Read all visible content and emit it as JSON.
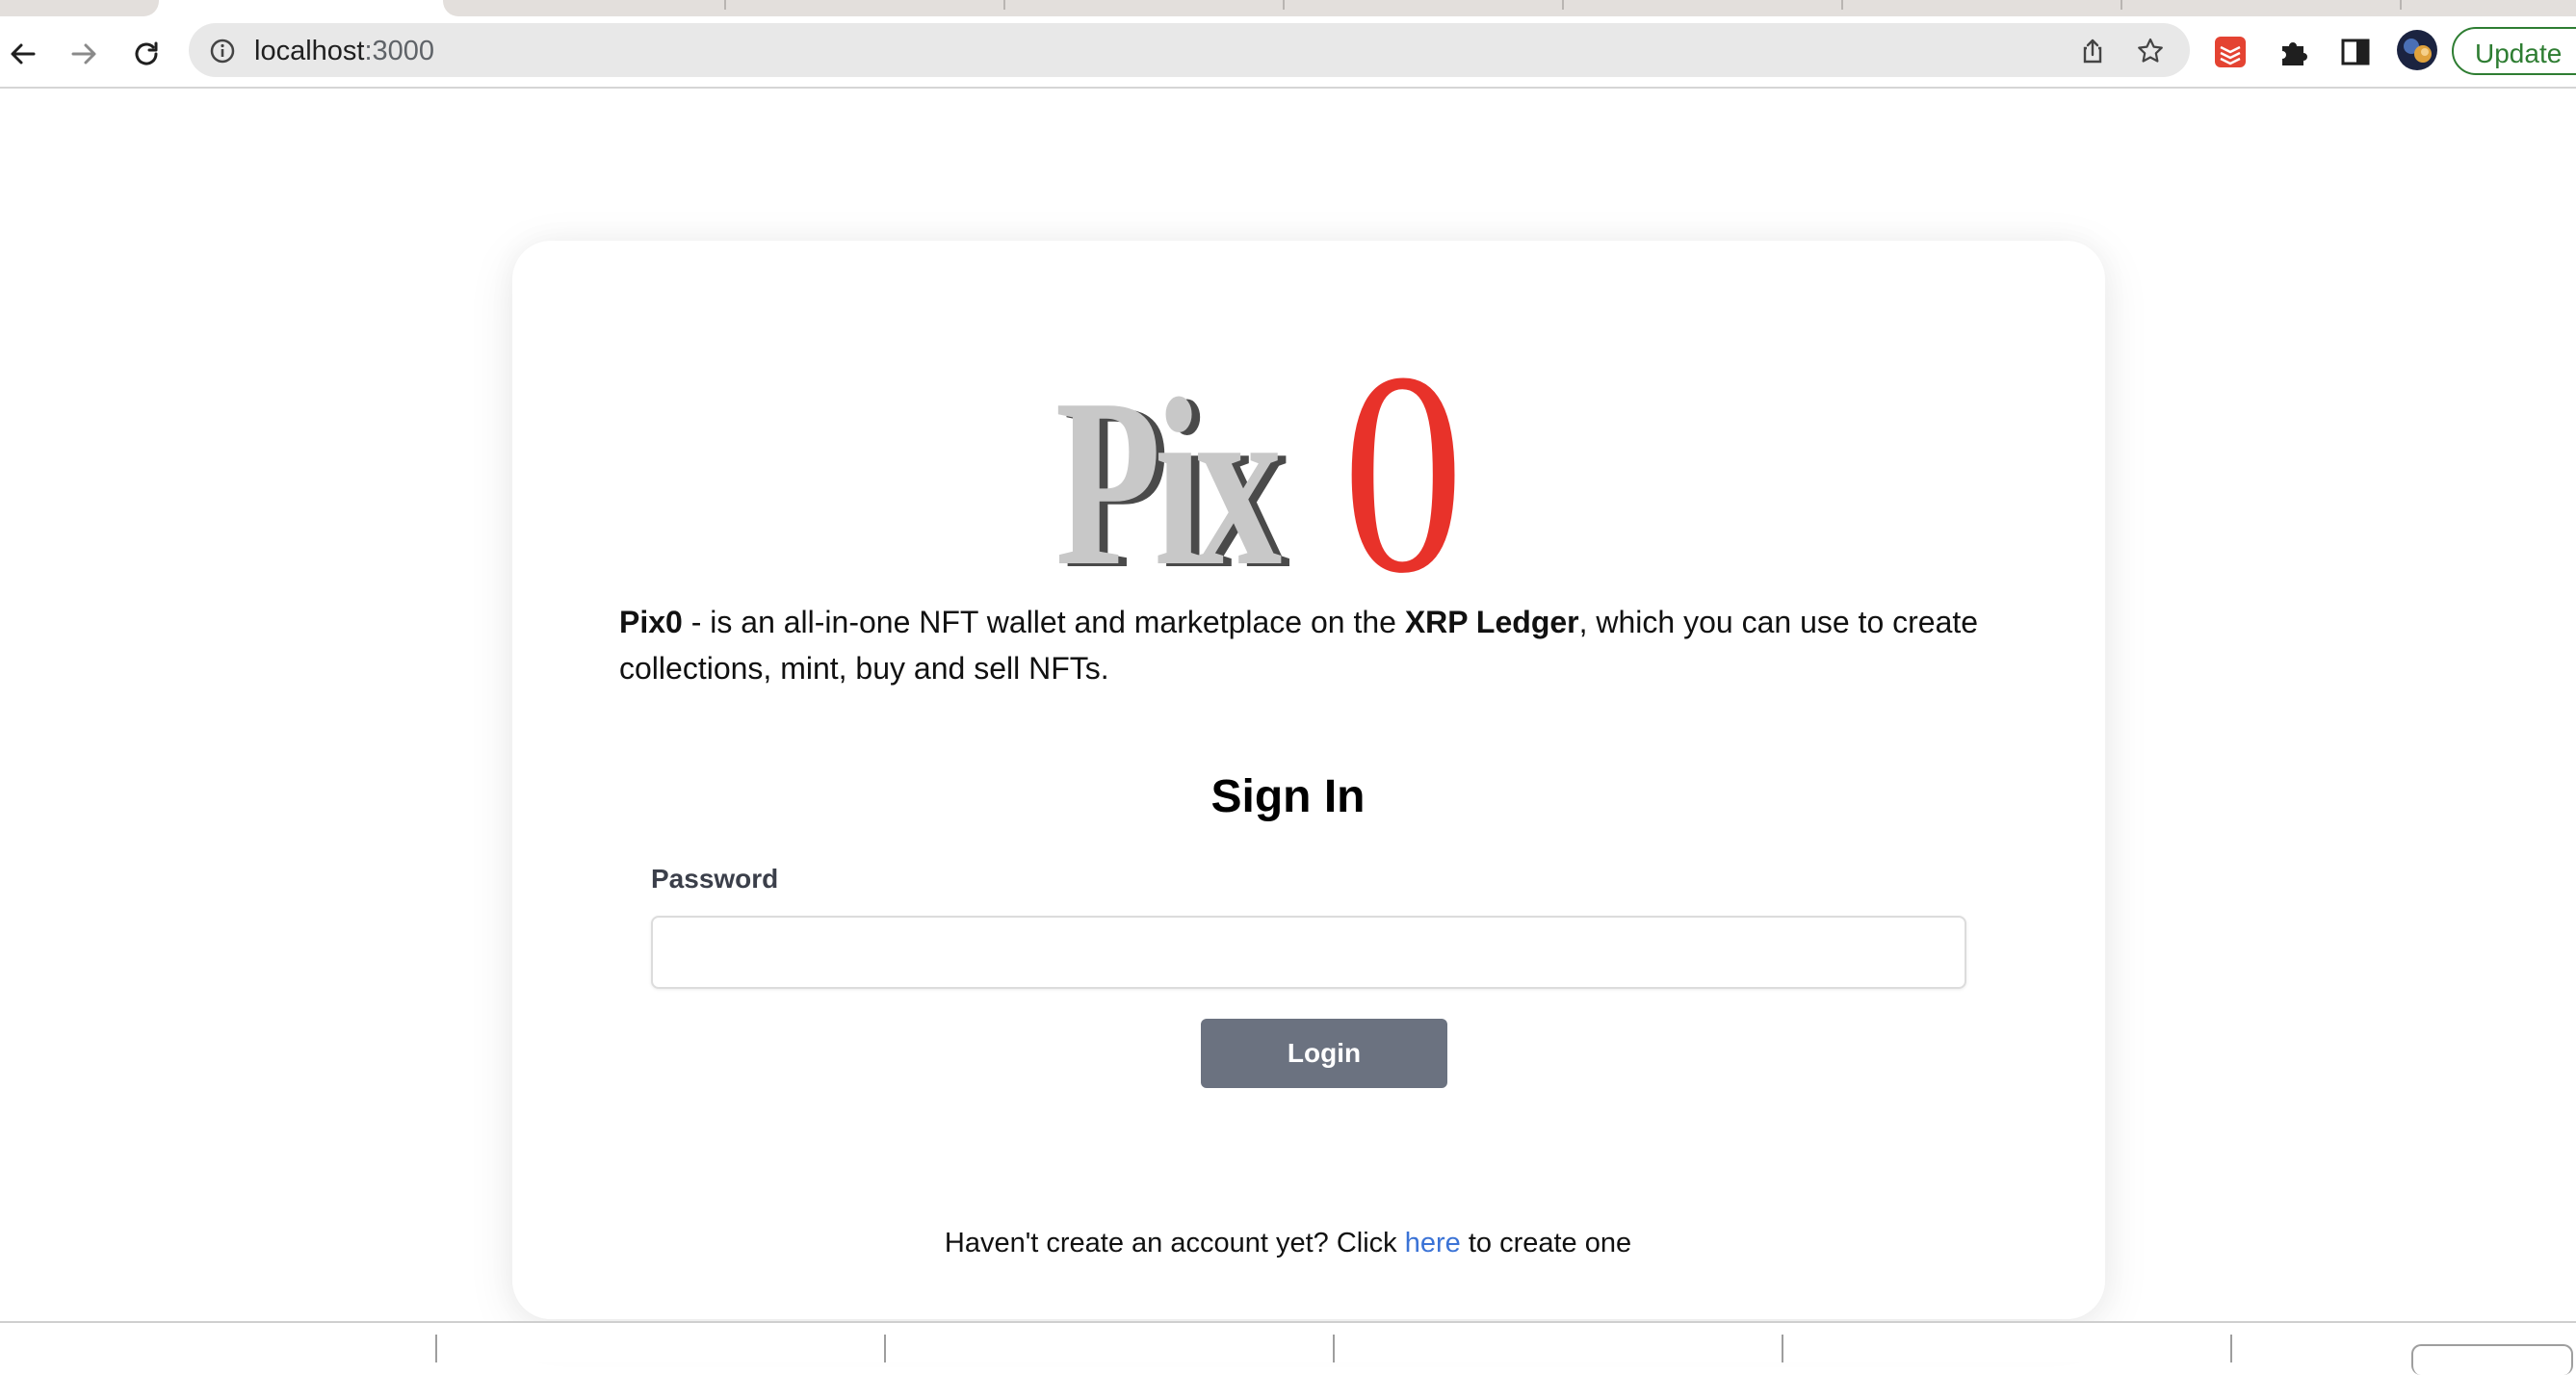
{
  "browser": {
    "url_host": "localhost",
    "url_port": ":3000",
    "update_label": "Update"
  },
  "icons": {
    "back": "arrow-left-icon",
    "forward": "arrow-right-icon",
    "reload": "reload-icon",
    "info": "info-icon",
    "share": "share-icon",
    "bookmark": "star-icon",
    "extension_todoist": "todoist-icon",
    "extensions": "puzzle-icon",
    "side_panel": "side-panel-icon",
    "profile": "avatar"
  },
  "page": {
    "logo_text": "Pix0",
    "description": {
      "brand": "Pix0",
      "part1": " - is an all-in-one NFT wallet and marketplace on the ",
      "ledger": "XRP Ledger",
      "part2": ", which you can use to create collections, mint, buy and sell NFTs."
    },
    "signin": {
      "title": "Sign In",
      "password_label": "Password",
      "password_value": "",
      "login_label": "Login"
    },
    "signup": {
      "prefix": "Haven't create an account yet? Click ",
      "link": "here",
      "suffix": " to create one"
    }
  },
  "colors": {
    "accent_red": "#e8322a",
    "login_button": "#6b7280",
    "link": "#3b73d6",
    "update_green": "#2e7d32"
  }
}
